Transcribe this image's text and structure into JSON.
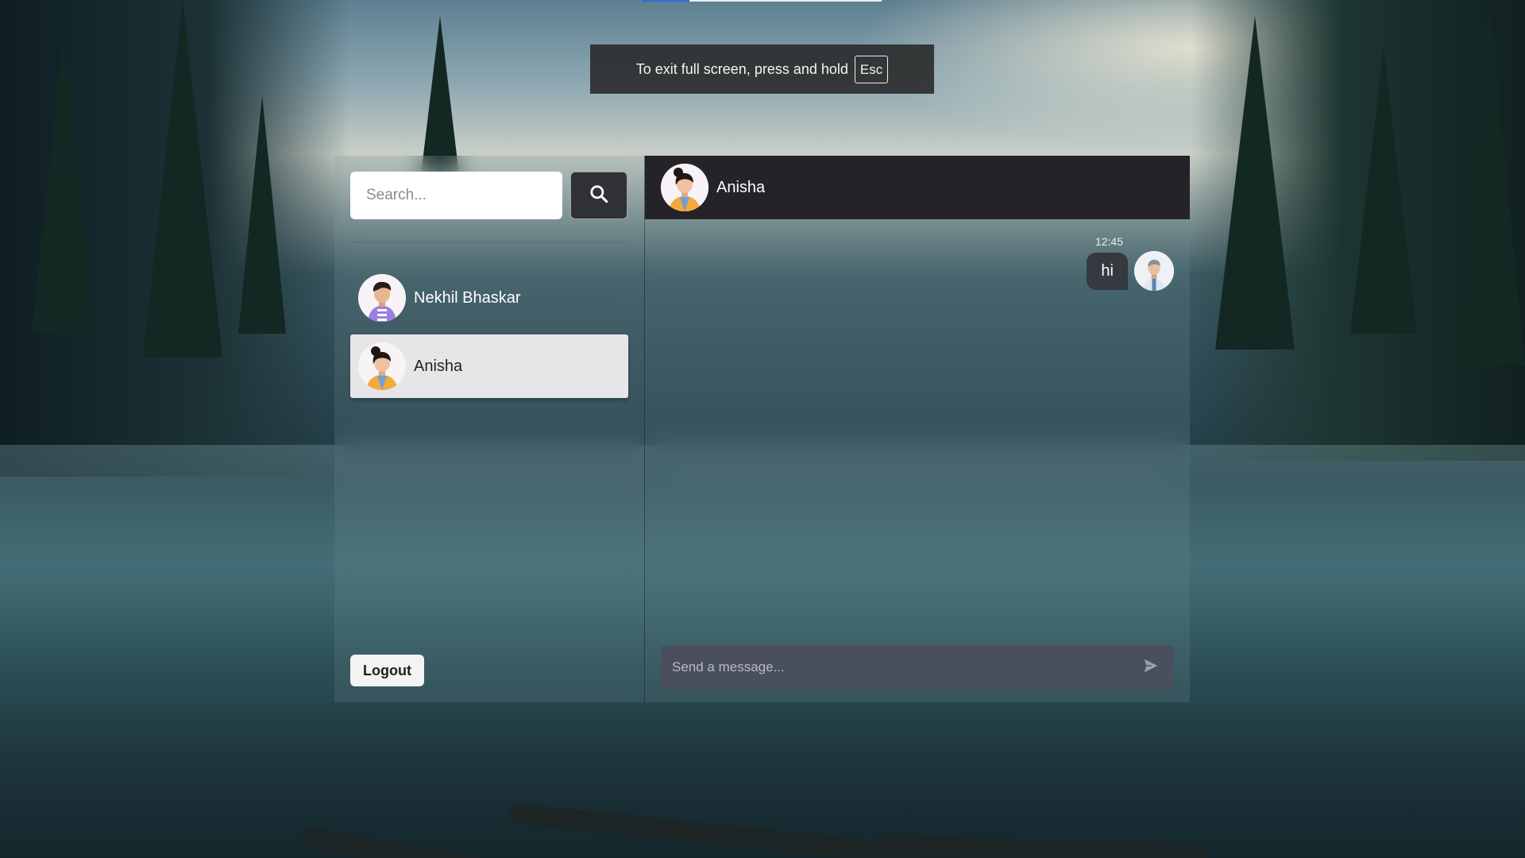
{
  "fullscreen_notice": {
    "text": "To exit full screen, press and hold",
    "key": "Esc"
  },
  "sidebar": {
    "search": {
      "placeholder": "Search...",
      "icon": "search-icon"
    },
    "chats": [
      {
        "name": "Nekhil Bhaskar",
        "active": false
      },
      {
        "name": "Anisha",
        "active": true
      }
    ],
    "logout_label": "Logout"
  },
  "conversation": {
    "header": {
      "name": "Anisha"
    },
    "messages": [
      {
        "time": "12:45",
        "text": "hi",
        "sender": "self"
      }
    ],
    "composer": {
      "placeholder": "Send a message...",
      "send_icon": "send-icon"
    }
  },
  "colors": {
    "header_bg": "#242428",
    "bubble_bg": "#343a40",
    "composer_bg": "#4a4f5e",
    "active_item_bg": "#e6e6e9"
  }
}
